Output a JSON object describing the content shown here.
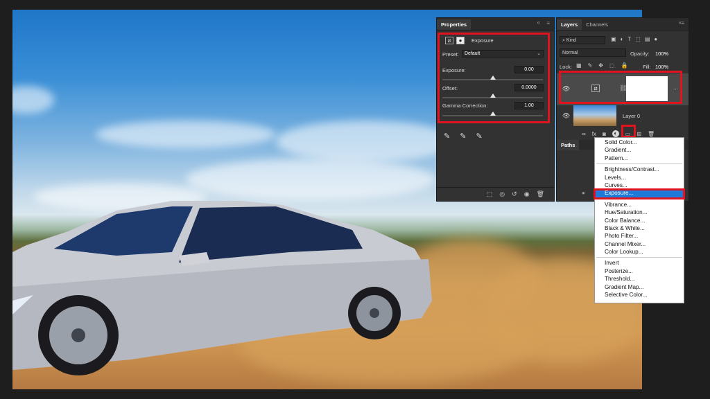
{
  "properties_panel": {
    "tab_label": "Properties",
    "adjustment_name": "Exposure",
    "preset_label": "Preset:",
    "preset_value": "Default",
    "exposure_label": "Exposure:",
    "exposure_value": "0.00",
    "exposure_level": 0.5,
    "offset_label": "Offset:",
    "offset_value": "0.0000",
    "offset_level": 0.5,
    "gamma_label": "Gamma Correction:",
    "gamma_value": "1.00",
    "gamma_level": 0.5
  },
  "layers_panel": {
    "tab_layers": "Layers",
    "tab_channels": "Channels",
    "kind_label": "Kind",
    "blend_mode": "Normal",
    "opacity_label": "Opacity:",
    "opacity_value": "100%",
    "lock_label": "Lock:",
    "fill_label": "Fill:",
    "fill_value": "100%",
    "layer0_name": "Layer 0",
    "layer_fx": "fx",
    "paths_tab": "Paths",
    "more": "..."
  },
  "adjustment_menu": {
    "group1": [
      "Solid Color...",
      "Gradient...",
      "Pattern..."
    ],
    "group2": [
      "Brightness/Contrast...",
      "Levels...",
      "Curves...",
      "Exposure..."
    ],
    "group3": [
      "Vibrance...",
      "Hue/Saturation...",
      "Color Balance...",
      "Black & White...",
      "Photo Filter...",
      "Channel Mixer...",
      "Color Lookup..."
    ],
    "group4": [
      "Invert",
      "Posterize...",
      "Threshold...",
      "Gradient Map...",
      "Selective Color..."
    ],
    "selected": "Exposure..."
  },
  "icons": {
    "collapse": "«",
    "menu": "≡",
    "visibility": "eye-icon",
    "eyedropper": "eyedropper-icon"
  },
  "colors": {
    "highlight_red": "#e0131f",
    "menu_selected": "#1e7bd9"
  }
}
